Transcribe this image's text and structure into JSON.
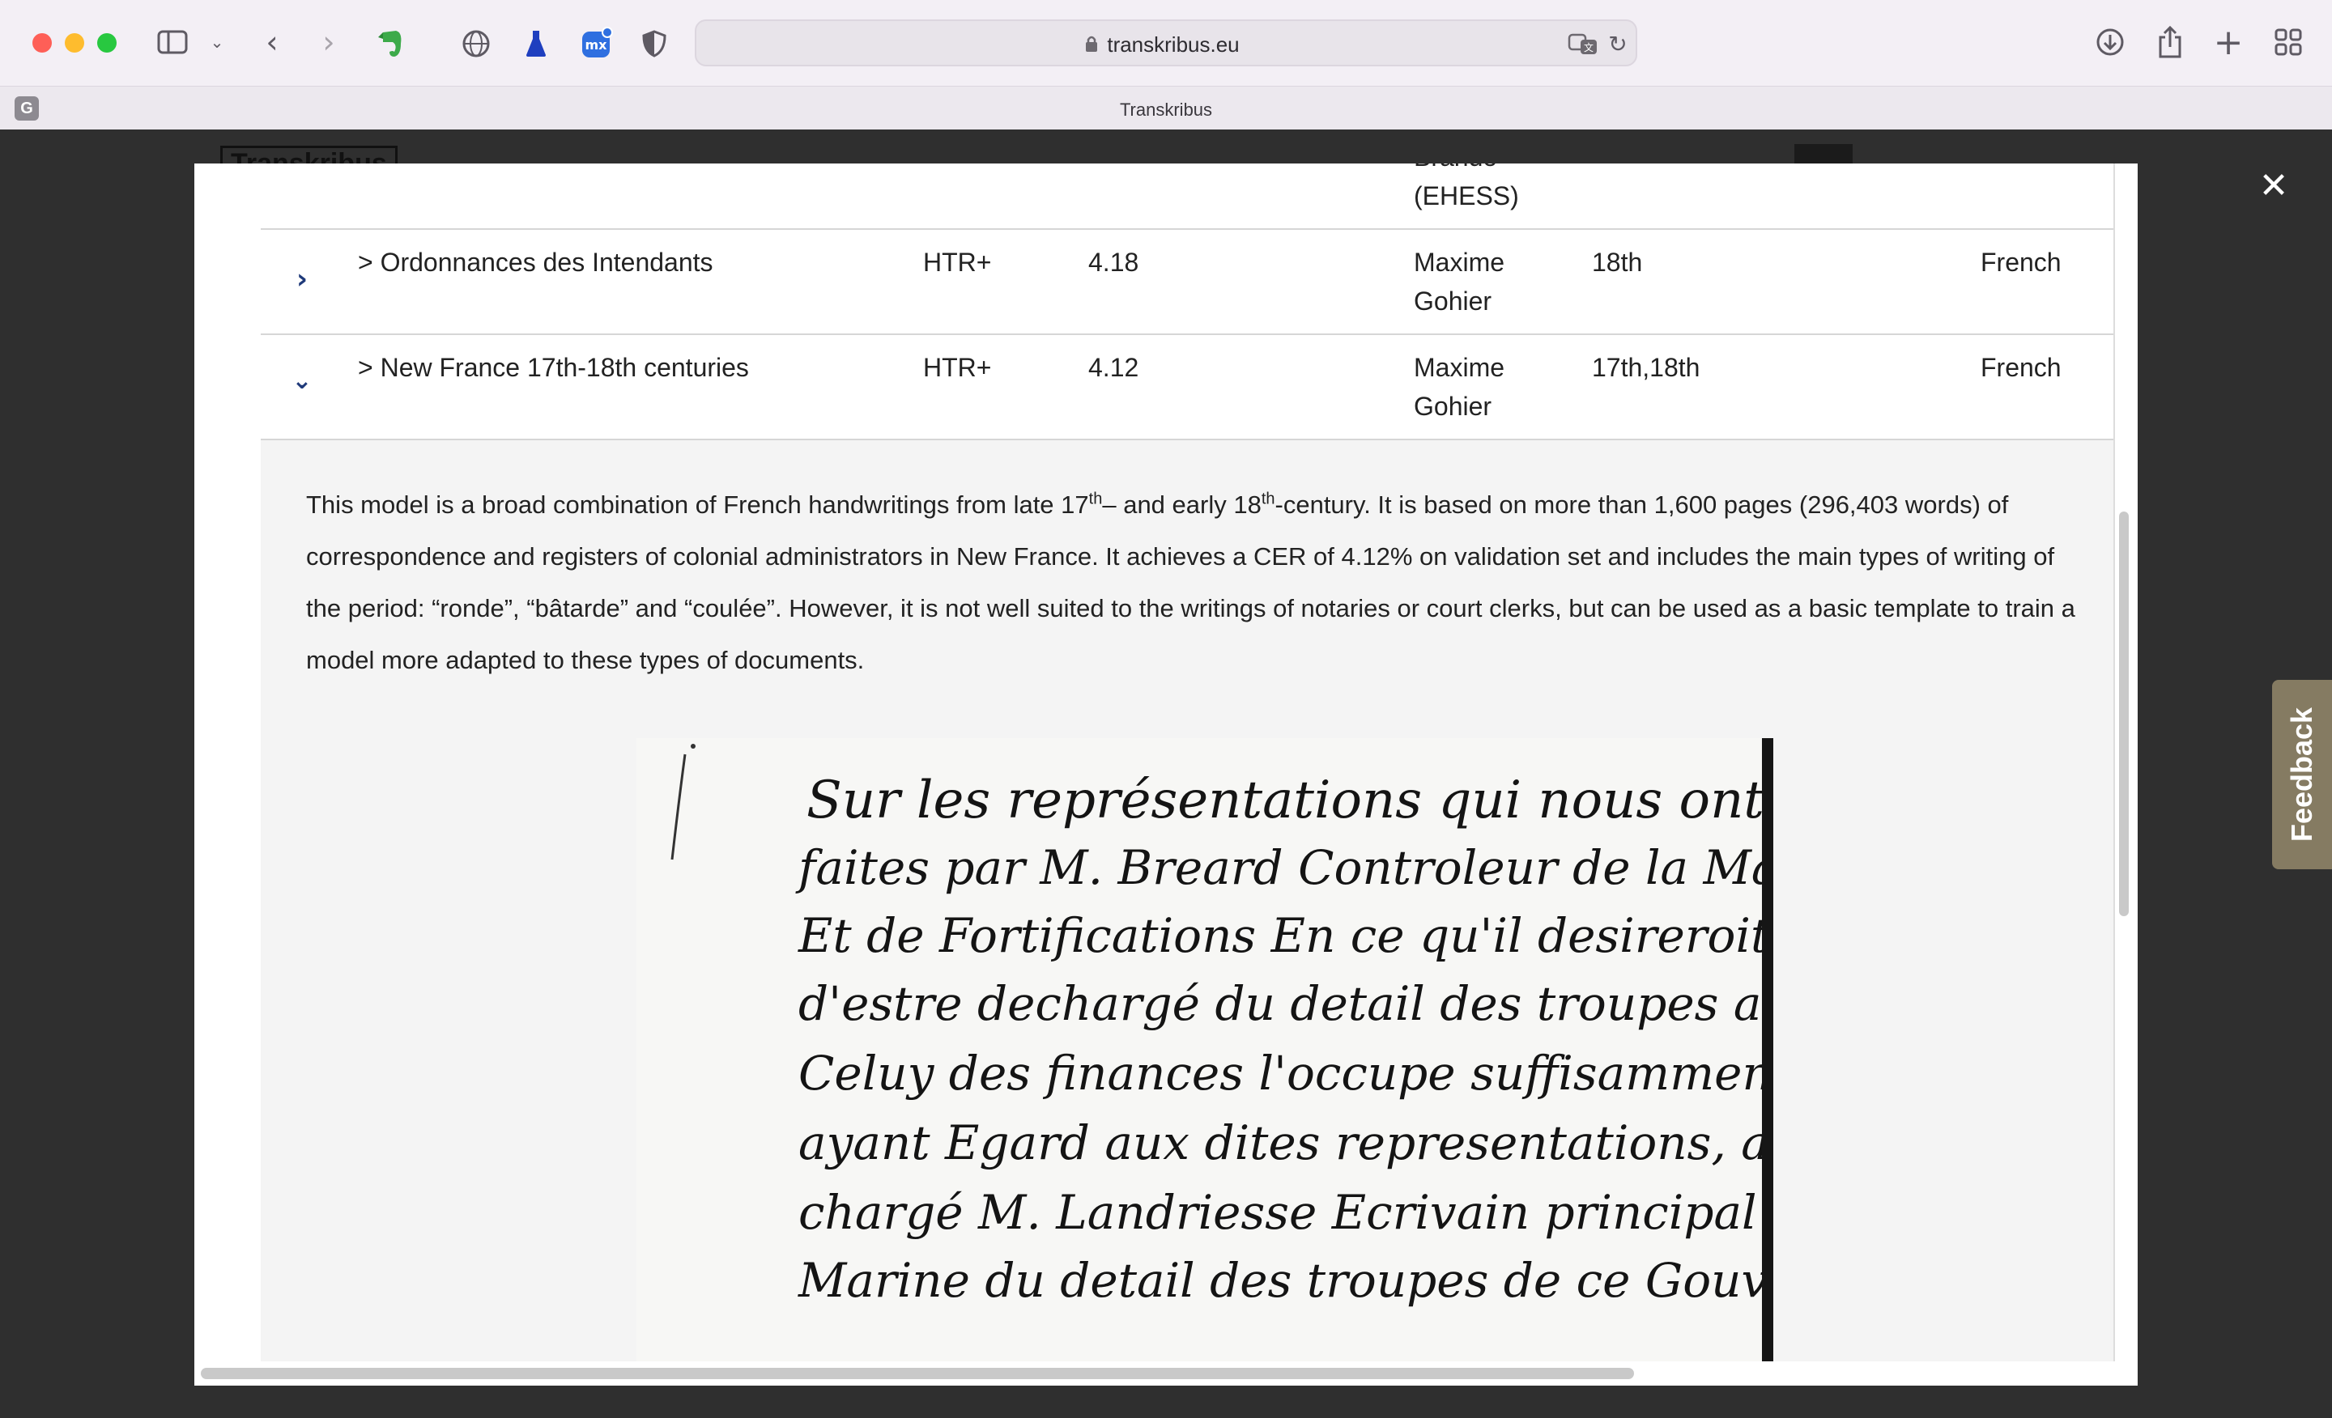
{
  "browser": {
    "url": "transkribus.eu",
    "tab_title": "Transkribus",
    "tab_favicon_letter": "G"
  },
  "icons": {
    "sidebar": "sidebar-icon",
    "back": "chevron-left-icon",
    "forward": "chevron-right-icon",
    "evernote": "evernote-icon",
    "globe": "globe-icon",
    "flask": "flask-icon",
    "extension": "extension-icon",
    "shield": "shield-icon",
    "lock": "lock-icon",
    "translate": "translate-icon",
    "reload": "reload-icon",
    "download": "download-icon",
    "share": "share-icon",
    "new_tab": "plus-icon",
    "tab_overview": "grid-icon",
    "close": "close-icon"
  },
  "colors": {
    "accent": "#1f3a7a",
    "feedback_bg": "#857b62"
  },
  "table": {
    "top_partial": "(EHESS)",
    "top_partial_cut": "Brando",
    "rows": [
      {
        "name": "> Ordonnances des Intendants",
        "type": "HTR+",
        "cer": "4.18",
        "creator_1": "Maxime",
        "creator_2": "Gohier",
        "century": "18th",
        "language": "French",
        "expanded": false
      },
      {
        "name": "> New France 17th-18th centuries",
        "type": "HTR+",
        "cer": "4.12",
        "creator_1": "Maxime",
        "creator_2": "Gohier",
        "century": "17th,18th",
        "language": "French",
        "expanded": true
      }
    ]
  },
  "description": {
    "part1": "This model is a broad combination of French handwritings from late 17",
    "sup1": "th",
    "part2": "– and early 18",
    "sup2": "th",
    "part3": "-century. It is based on more than 1,600 pages (296,403 words) of correspondence and registers of colonial administrators in New France. It achieves a CER of 4.12% on validation set and includes the main types of writing of the period: “ronde”, “bâtarde” and “coulée”. However, it is not well suited to the writings of notaries or court clerks, but can be used as a basic template to train a model more adapted to these types of documents."
  },
  "manuscript": {
    "lines": [
      "Sur les représentations qui nous ont faites",
      "faites par M. Breard Controleur de la Marine",
      "Et de Fortifications En ce qu'il desireroit",
      "d'estre dechargé du detail des troupes attendu que",
      "Celuy des finances l'occupe suffisamment, Nous",
      "ayant Egard aux dites representations, avons",
      "chargé M. Landriesse Ecrivain principal de la",
      "Marine du detail des troupes de ce Gouvernement"
    ]
  },
  "feedback_label": "Feedback"
}
